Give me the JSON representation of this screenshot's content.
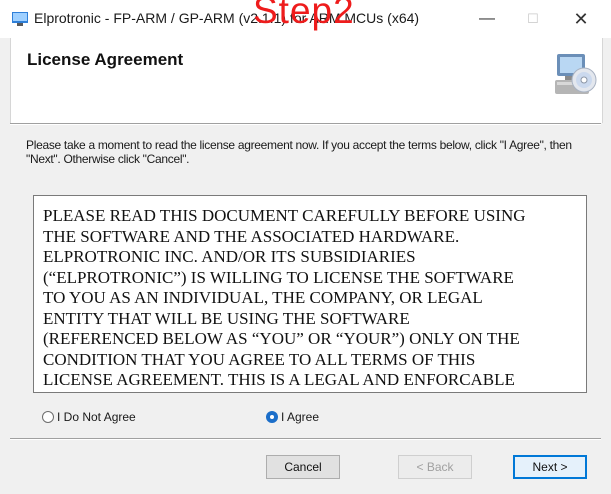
{
  "window": {
    "title": "Elprotronic - FP-ARM / GP-ARM (v2.1.1) for ARM MCUs (x64)",
    "minimize_glyph": "—",
    "maximize_glyph": "☐",
    "close_glyph": "✕"
  },
  "overlay": {
    "text": "Step2",
    "color": "#ee1c1c"
  },
  "header": {
    "title": "License Agreement",
    "icon": "computer-cd-icon"
  },
  "instructions": "Please take a moment to read the license agreement now. If you accept the terms below, click \"I Agree\", then \"Next\". Otherwise click \"Cancel\".",
  "license_lines": [
    "PLEASE READ THIS DOCUMENT CAREFULLY BEFORE USING",
    "THE SOFTWARE AND THE ASSOCIATED HARDWARE.",
    "ELPROTRONIC INC. AND/OR ITS SUBSIDIARIES",
    "(“ELPROTRONIC”) IS WILLING TO LICENSE THE SOFTWARE",
    "TO YOU AS AN INDIVIDUAL, THE COMPANY, OR LEGAL",
    "ENTITY THAT WILL BE USING THE SOFTWARE",
    "(REFERENCED BELOW AS “YOU” OR “YOUR”) ONLY ON THE",
    "CONDITION THAT YOU AGREE TO ALL TERMS OF THIS",
    "LICENSE AGREEMENT. THIS IS A LEGAL AND ENFORCABLE"
  ],
  "radios": {
    "disagree_label": "I Do Not Agree",
    "agree_label": "I Agree",
    "selected": "agree"
  },
  "buttons": {
    "cancel": "Cancel",
    "back": "< Back",
    "next": "Next >"
  },
  "colors": {
    "accent": "#0078d7",
    "radio_selected": "#1b6ec9"
  }
}
